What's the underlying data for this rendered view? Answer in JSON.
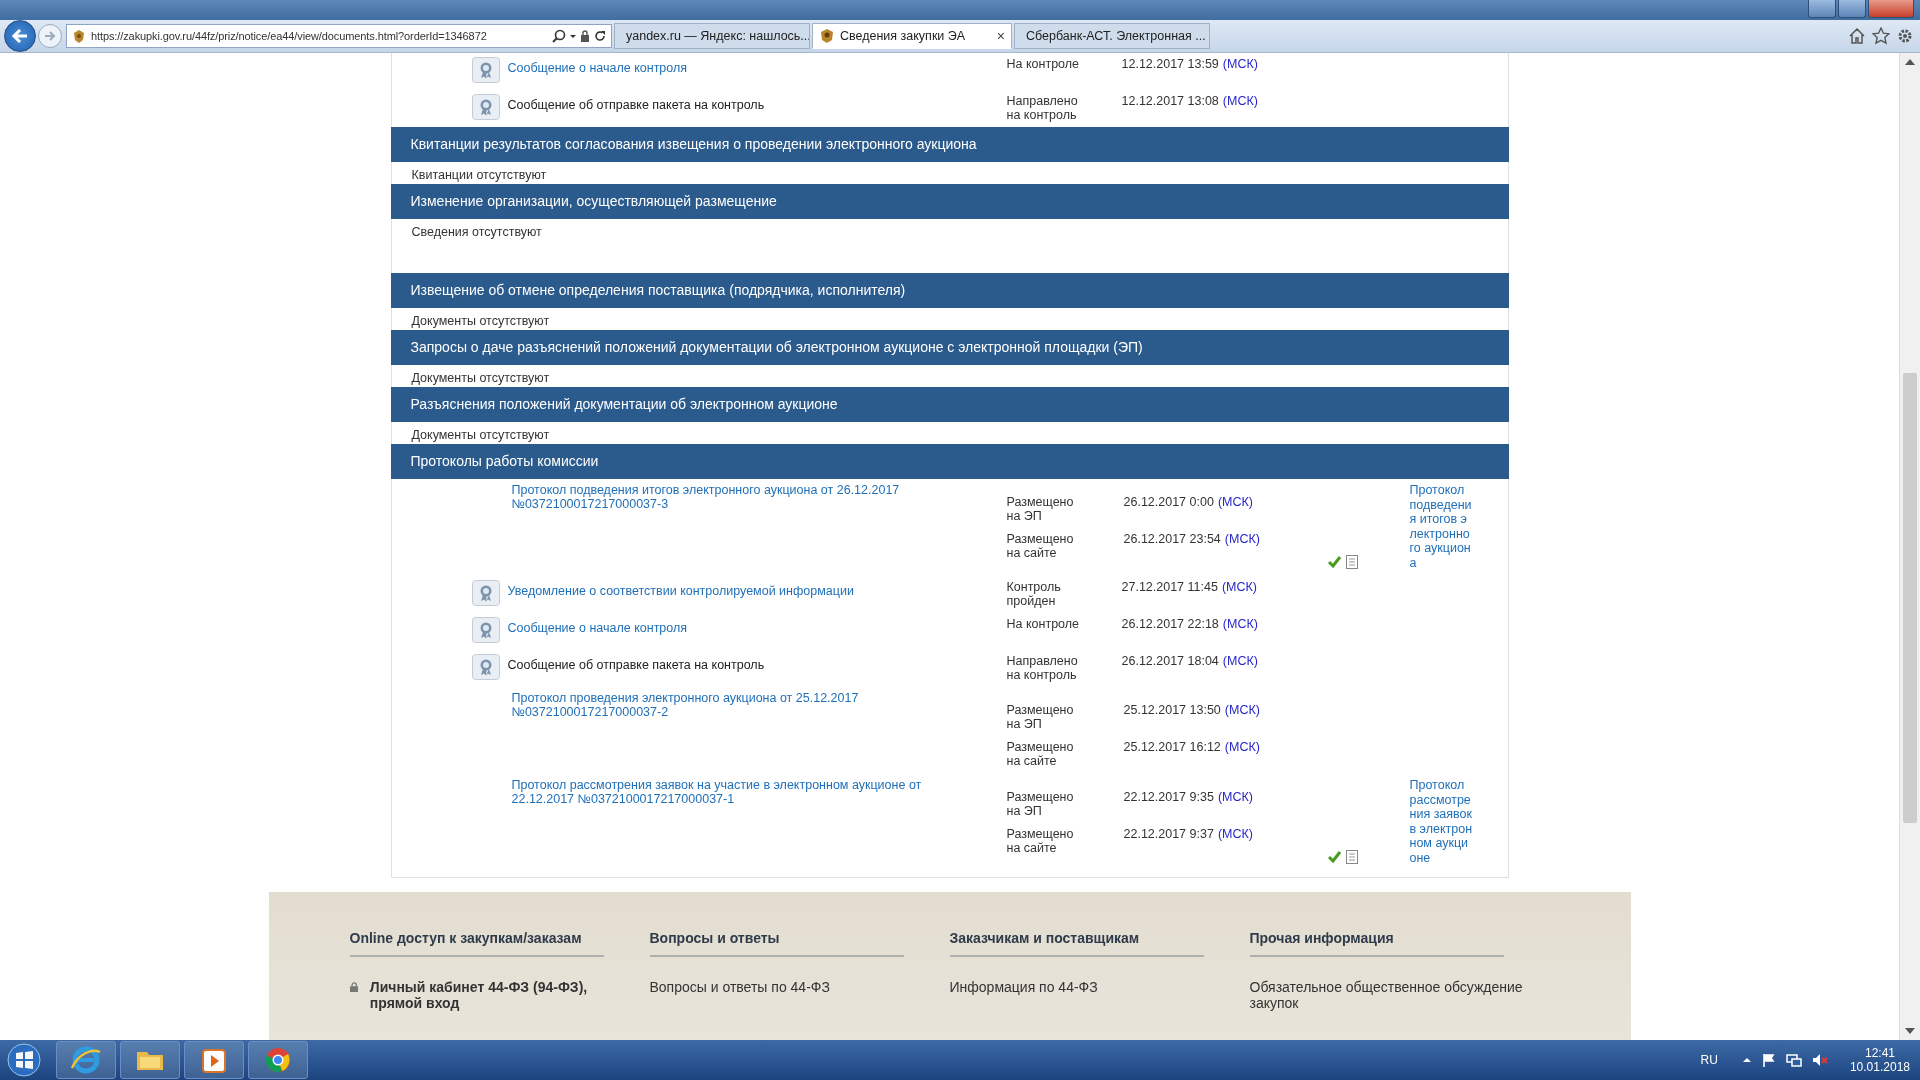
{
  "browser": {
    "url": "https://zakupki.gov.ru/44fz/priz/notice/ea44/view/documents.html?orderId=1346872",
    "tabs": [
      {
        "label": "yandex.ru — Яндекс: нашлось...",
        "selected": false
      },
      {
        "label": "Сведения закупки ЭА",
        "selected": true,
        "close": "×"
      },
      {
        "label": "Сбербанк-АСТ. Электронная ...",
        "selected": false
      }
    ]
  },
  "top_items": [
    {
      "kind": "control",
      "title": "Сообщение о начале контроля",
      "linked": true,
      "status": "На контроле",
      "date": "12.12.2017 13:59",
      "tz": "(МСК)"
    },
    {
      "kind": "control",
      "title": "Сообщение об отправке пакета на контроль",
      "linked": false,
      "status": "Направлено на контроль",
      "date": "12.12.2017 13:08",
      "tz": "(МСК)"
    }
  ],
  "sections": [
    {
      "title": "Квитанции результатов согласования извещения о проведении электронного аукциона",
      "empty_text": "Квитанции отсутствуют",
      "spacer": false
    },
    {
      "title": "Изменение организации, осуществляющей размещение",
      "empty_text": "Сведения отсутствуют",
      "spacer": true
    },
    {
      "title": "Извещение об отмене определения поставщика (подрядчика, исполнителя)",
      "empty_text": "Документы отсутствуют",
      "spacer": false
    },
    {
      "title": "Запросы о даче разъяснений положений документации об электронном аукционе с электронной площадки (ЭП)",
      "empty_text": "Документы отсутствуют",
      "spacer": false
    },
    {
      "title": "Разъяснения положений документации об электронном аукционе",
      "empty_text": "Документы отсутствуют",
      "spacer": false
    },
    {
      "title": "Протоколы работы комиссии",
      "items": [
        {
          "kind": "document",
          "title": "Протокол подведения итогов электронного аукциона от 26.12.2017 №0372100017217000037-3",
          "entries": [
            {
              "status": "Размещено на ЭП",
              "date": "26.12.2017 0:00",
              "tz": "(МСК)"
            },
            {
              "status": "Размещено на сайте",
              "date": "26.12.2017 23:54",
              "tz": "(МСК)"
            }
          ],
          "signed": true,
          "side_link": "Протокол подведения итогов электронного аукциона"
        },
        {
          "kind": "control",
          "title": "Уведомление о соответствии контролируемой информации",
          "linked": true,
          "status": "Контроль пройден",
          "date": "27.12.2017 11:45",
          "tz": "(МСК)"
        },
        {
          "kind": "control",
          "title": "Сообщение о начале контроля",
          "linked": true,
          "status": "На контроле",
          "date": "26.12.2017 22:18",
          "tz": "(МСК)"
        },
        {
          "kind": "control",
          "title": "Сообщение об отправке пакета на контроль",
          "linked": false,
          "status": "Направлено на контроль",
          "date": "26.12.2017 18:04",
          "tz": "(МСК)"
        },
        {
          "kind": "document",
          "title": "Протокол проведения электронного аукциона от 25.12.2017 №0372100017217000037-2",
          "entries": [
            {
              "status": "Размещено на ЭП",
              "date": "25.12.2017 13:50",
              "tz": "(МСК)"
            },
            {
              "status": "Размещено на сайте",
              "date": "25.12.2017 16:12",
              "tz": "(МСК)"
            }
          ],
          "signed": false
        },
        {
          "kind": "document",
          "title": "Протокол рассмотрения заявок на участие в электронном аукционе от 22.12.2017 №0372100017217000037-1",
          "entries": [
            {
              "status": "Размещено на ЭП",
              "date": "22.12.2017 9:35",
              "tz": "(МСК)"
            },
            {
              "status": "Размещено на сайте",
              "date": "22.12.2017 9:37",
              "tz": "(МСК)"
            }
          ],
          "signed": true,
          "side_link": "Протокол рассмотрения заявок в электронном аукционе"
        }
      ]
    }
  ],
  "footer": [
    {
      "heading": "Online доступ к закупкам/заказам",
      "links": [
        {
          "text": "Личный кабинет 44-ФЗ (94-ФЗ), прямой вход",
          "locked": true
        }
      ]
    },
    {
      "heading": "Вопросы и ответы",
      "links": [
        {
          "text": "Вопросы и ответы по 44-ФЗ",
          "locked": false
        }
      ]
    },
    {
      "heading": "Заказчикам и поставщикам",
      "links": [
        {
          "text": "Информация по 44-ФЗ",
          "locked": false
        }
      ]
    },
    {
      "heading": "Прочая информация",
      "links": [
        {
          "text": "Обязательное общественное обсуждение закупок",
          "locked": false
        }
      ]
    }
  ],
  "taskbar": {
    "language": "RU",
    "time": "12:41",
    "date": "10.01.2018"
  }
}
